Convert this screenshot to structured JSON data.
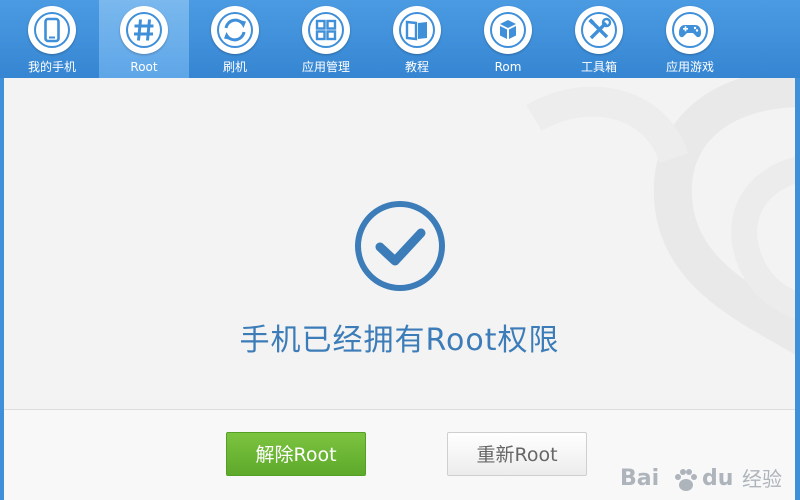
{
  "nav": {
    "items": [
      {
        "label": "我的手机",
        "icon": "phone-icon"
      },
      {
        "label": "Root",
        "icon": "hash-icon",
        "active": true
      },
      {
        "label": "刷机",
        "icon": "refresh-icon"
      },
      {
        "label": "应用管理",
        "icon": "grid-icon"
      },
      {
        "label": "教程",
        "icon": "book-icon"
      },
      {
        "label": "Rom",
        "icon": "box-icon"
      },
      {
        "label": "工具箱",
        "icon": "tools-icon"
      },
      {
        "label": "应用游戏",
        "icon": "gamepad-icon"
      }
    ]
  },
  "status": {
    "icon": "check-circle-icon",
    "message": "手机已经拥有Root权限"
  },
  "actions": {
    "unroot_label": "解除Root",
    "reroot_label": "重新Root"
  },
  "watermark": {
    "brand_left": "Bai",
    "brand_right": "du",
    "suffix": "经验",
    "icon": "paw-icon"
  },
  "colors": {
    "nav_blue": "#3f8fd9",
    "accent_blue": "#3c7cb8",
    "primary_green": "#6ab532"
  }
}
